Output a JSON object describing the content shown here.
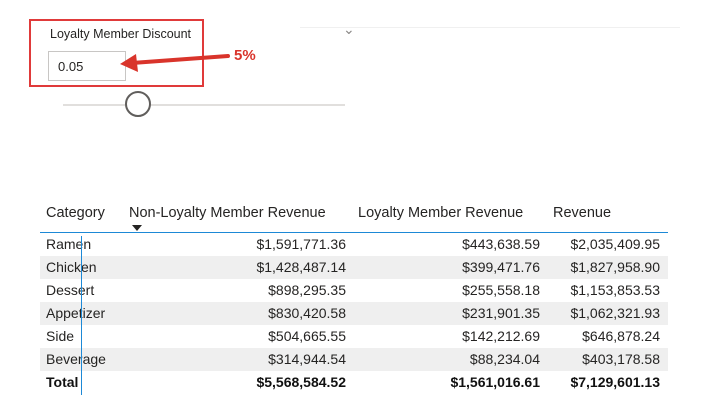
{
  "slicer": {
    "title": "Loyalty Member Discount",
    "value": "0.05",
    "slider_level": 0.05
  },
  "annotation": {
    "label": "5%",
    "color": "#d9342b"
  },
  "colors": {
    "highlight_box": "#e03a3a",
    "table_accent": "#1d89d6",
    "band_row": "#efefef"
  },
  "icons": {
    "slicer_menu": "chevron-down-icon",
    "sort": "sort-descending-icon"
  },
  "table": {
    "headers": [
      "Category",
      "Non-Loyalty Member Revenue",
      "Loyalty Member Revenue",
      "Revenue"
    ],
    "rows": [
      [
        "Ramen",
        "$1,591,771.36",
        "$443,638.59",
        "$2,035,409.95"
      ],
      [
        "Chicken",
        "$1,428,487.14",
        "$399,471.76",
        "$1,827,958.90"
      ],
      [
        "Dessert",
        "$898,295.35",
        "$255,558.18",
        "$1,153,853.53"
      ],
      [
        "Appetizer",
        "$830,420.58",
        "$231,901.35",
        "$1,062,321.93"
      ],
      [
        "Side",
        "$504,665.55",
        "$142,212.69",
        "$646,878.24"
      ],
      [
        "Beverage",
        "$314,944.54",
        "$88,234.04",
        "$403,178.58"
      ]
    ],
    "total": [
      "Total",
      "$5,568,584.52",
      "$1,561,016.61",
      "$7,129,601.13"
    ]
  }
}
